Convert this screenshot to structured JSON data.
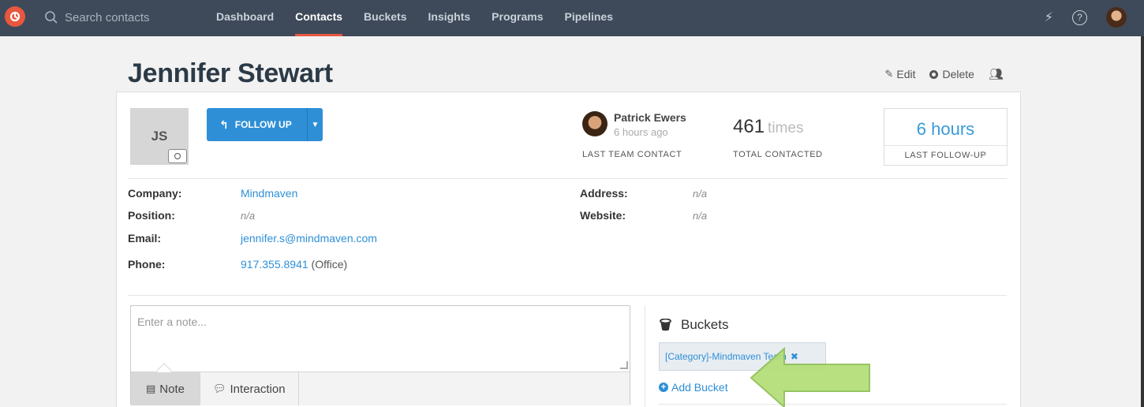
{
  "nav": {
    "search_placeholder": "Search contacts",
    "items": [
      {
        "label": "Dashboard",
        "active": false
      },
      {
        "label": "Contacts",
        "active": true
      },
      {
        "label": "Buckets",
        "active": false
      },
      {
        "label": "Insights",
        "active": false
      },
      {
        "label": "Programs",
        "active": false
      },
      {
        "label": "Pipelines",
        "active": false
      }
    ],
    "help_label": "?"
  },
  "contact": {
    "name": "Jennifer Stewart",
    "initials": "JS",
    "actions": {
      "edit": "Edit",
      "delete": "Delete"
    }
  },
  "follow_up": {
    "label": "FOLLOW UP"
  },
  "last_team_contact": {
    "person": "Patrick Ewers",
    "time": "6 hours ago",
    "label": "LAST TEAM CONTACT"
  },
  "total_contacted": {
    "count": "461",
    "unit": "times",
    "label": "TOTAL CONTACTED"
  },
  "last_follow_up": {
    "value": "6 hours",
    "label": "LAST FOLLOW-UP"
  },
  "details": {
    "company": {
      "label": "Company:",
      "value": "Mindmaven"
    },
    "position": {
      "label": "Position:",
      "value": "n/a"
    },
    "email": {
      "label": "Email:",
      "value": "jennifer.s@mindmaven.com"
    },
    "phone": {
      "label": "Phone:",
      "value": "917.355.8941",
      "type": "(Office)"
    },
    "address": {
      "label": "Address:",
      "value": "n/a"
    },
    "website": {
      "label": "Website:",
      "value": "n/a"
    }
  },
  "note": {
    "placeholder": "Enter a note...",
    "tabs": [
      {
        "label": "Note"
      },
      {
        "label": "Interaction"
      }
    ]
  },
  "buckets": {
    "title": "Buckets",
    "tag": "[Category]-Mindmaven Team",
    "tag_remove": "✖",
    "add_label": "Add Bucket"
  },
  "colors": {
    "topbar": "#3e4a59",
    "accent": "#e9573f",
    "link": "#2e8fd6",
    "follow_button": "#2e8fd6",
    "arrow": "#a9d86e"
  }
}
